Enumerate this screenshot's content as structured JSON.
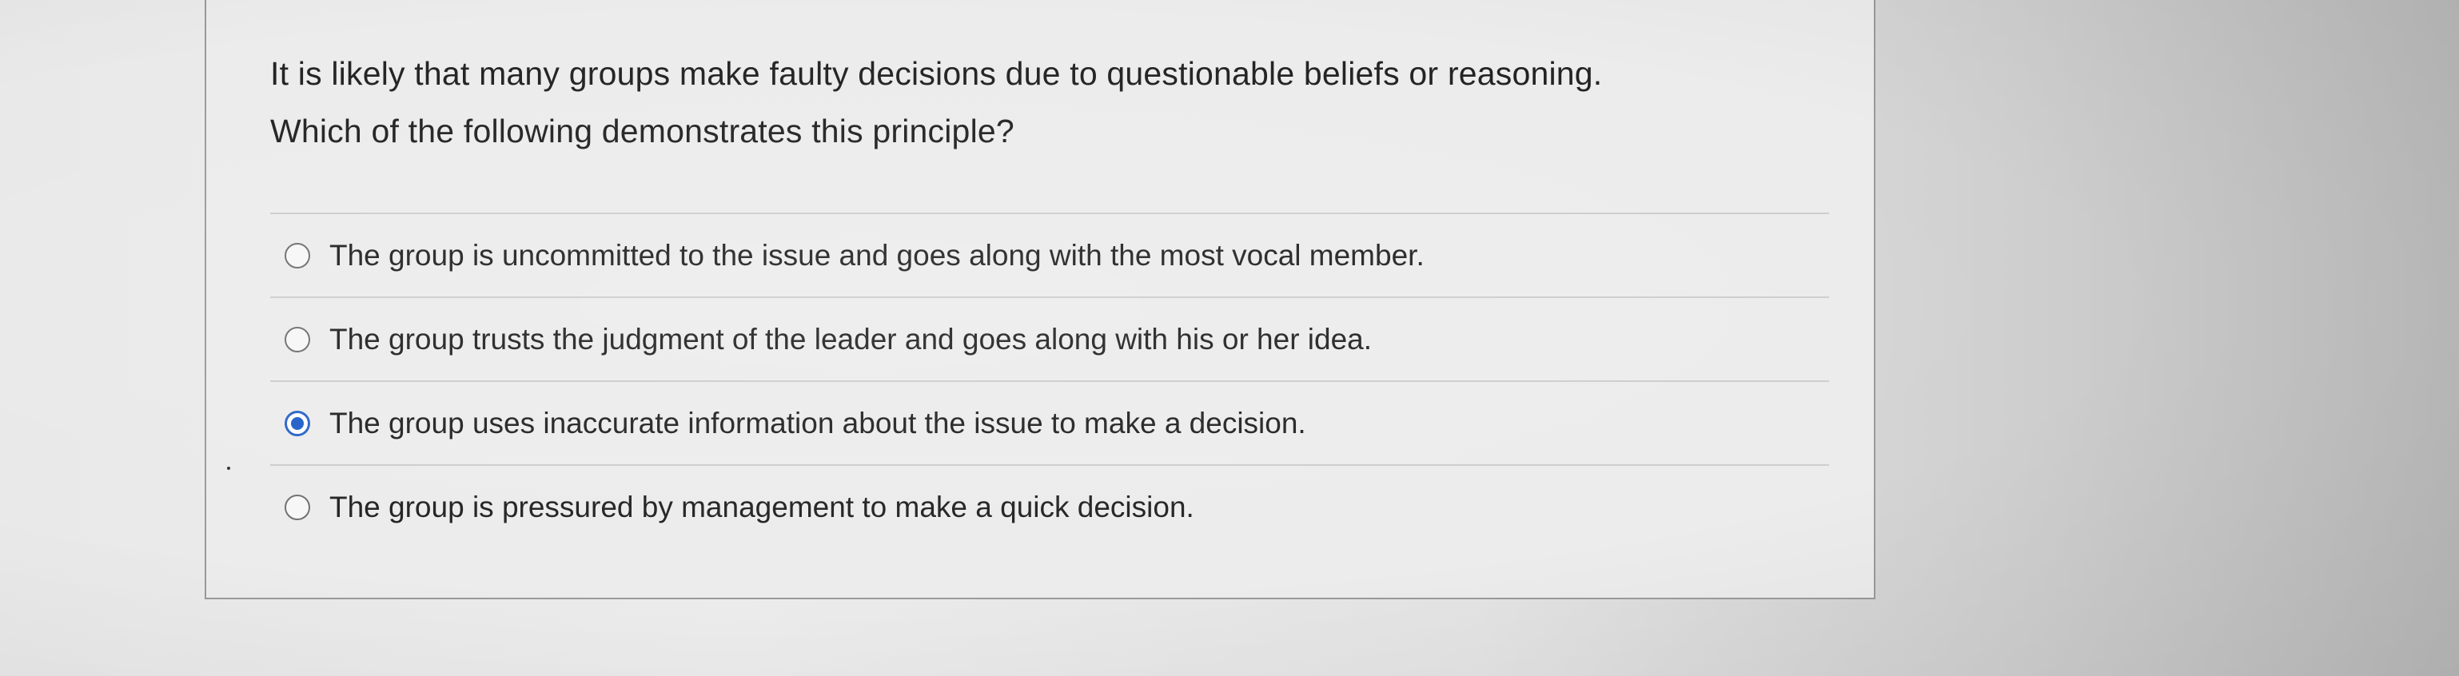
{
  "question": {
    "line1": "It is likely that many groups make faulty decisions due to questionable beliefs or reasoning.",
    "line2": "Which of the following demonstrates this principle?"
  },
  "answers": [
    {
      "label": "The group is uncommitted to the issue and goes along with the most vocal member.",
      "selected": false
    },
    {
      "label": "The group trusts the judgment of the leader and goes along with his or her idea.",
      "selected": false
    },
    {
      "label": "The group uses inaccurate information about the issue to make a decision.",
      "selected": true
    },
    {
      "label": "The group is pressured by management to make a quick decision.",
      "selected": false
    }
  ],
  "colors": {
    "selected_radio": "#1f5fc8",
    "text": "#222222",
    "card_border": "#9a9a9a"
  }
}
